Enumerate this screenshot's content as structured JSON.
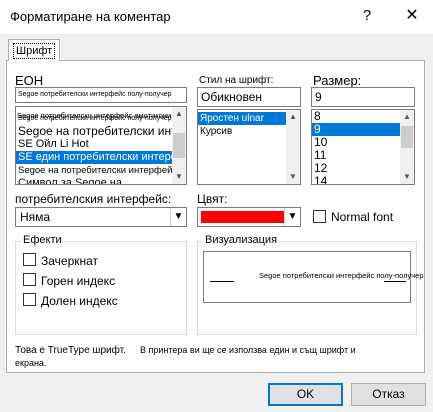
{
  "window": {
    "title": "Форматиране на коментар",
    "help_glyph": "?",
    "close_glyph": "✕"
  },
  "tabs": [
    {
      "label": "Шрифт",
      "active": true
    }
  ],
  "font": {
    "label": "ЕОН",
    "current_value": "Segoe потребителски интерфейс полу-получер",
    "items": [
      {
        "label": "Segoe потребителски интерфейс полу-получер"
      },
      {
        "label": "Segoe потребителски интерфейс емотикони"
      },
      {
        "label": "Segoe на потребителски интерфейс"
      },
      {
        "label": "SE Ойл Li Hot"
      },
      {
        "label": "SE един потребителски интерфейс Se"
      },
      {
        "label": "Segoe на потребителски интерфейс на Semilight"
      },
      {
        "label": "Символ за Segoe на"
      }
    ],
    "selected_index": 4
  },
  "style": {
    "label": "Стил на шрифт:",
    "current_value": "Обикновен",
    "items": [
      {
        "label": "Яростен ulnar"
      },
      {
        "label": "Курсив"
      }
    ],
    "selected_index": 0
  },
  "size": {
    "label": "Размер:",
    "current_value": "9",
    "items": [
      "8",
      "9",
      "10",
      "11",
      "12",
      "14"
    ],
    "selected_index": 1
  },
  "underline": {
    "label": "потребителския интерфейс:",
    "value": "Няма"
  },
  "color": {
    "label": "Цвят:",
    "swatch": "#ff0000"
  },
  "normal_font": {
    "label": "Normal font",
    "checked": false
  },
  "effects": {
    "title": "Ефекти",
    "strikethrough": "Зачеркнат",
    "superscript": "Горен индекс",
    "subscript": "Долен индекс"
  },
  "preview": {
    "title": "Визуализация",
    "text": "Segoe потребителски интерфейс полу-получер"
  },
  "info": {
    "left": "Това е TrueType шрифт.",
    "right": "В принтера ви ще се използва един и същ шрифт и",
    "line2": "екрана."
  },
  "buttons": {
    "ok": "OK",
    "cancel": "Отказ"
  },
  "colors": {
    "selection": "#0078d7",
    "dialog_bg": "#f0f0f0",
    "accent_border": "#0078d7"
  }
}
